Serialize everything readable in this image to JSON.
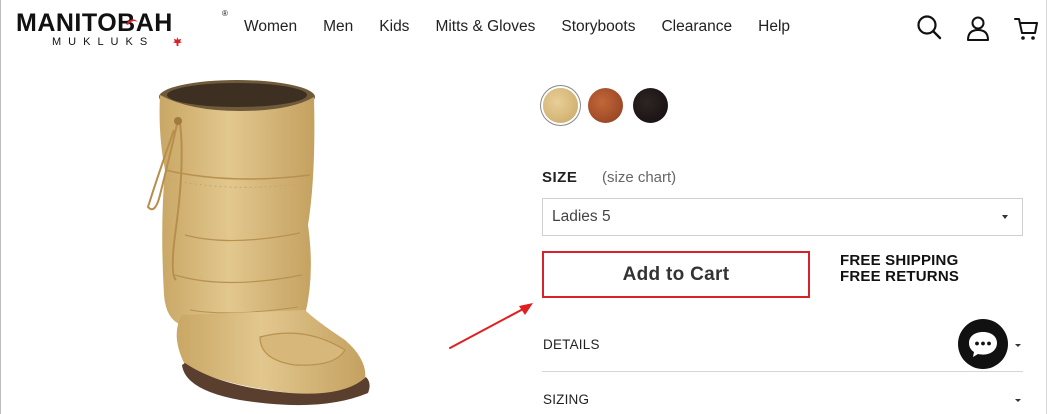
{
  "brand": {
    "name": "MANITOBAH",
    "registered": "®",
    "sub": "MUKLUKS"
  },
  "nav": {
    "items": [
      "Women",
      "Men",
      "Kids",
      "Mitts & Gloves",
      "Storyboots",
      "Clearance",
      "Help"
    ]
  },
  "header_icons": [
    "search-icon",
    "account-icon",
    "cart-icon"
  ],
  "product": {
    "swatches": [
      {
        "name": "tan-swatch",
        "color": "#d9b77a",
        "selected": true
      },
      {
        "name": "brown-swatch",
        "color": "#a9502a",
        "selected": false
      },
      {
        "name": "black-swatch",
        "color": "#1c1414",
        "selected": false
      }
    ],
    "size_label": "SIZE",
    "size_chart_link": "(size chart)",
    "size_selected": "Ladies 5",
    "add_to_cart": "Add to Cart",
    "shipping_line1": "FREE SHIPPING",
    "shipping_line2": "FREE RETURNS",
    "accordion": [
      "DETAILS",
      "SIZING"
    ]
  },
  "colors": {
    "accent_red": "#d8222a",
    "chat_bg": "#111111"
  }
}
